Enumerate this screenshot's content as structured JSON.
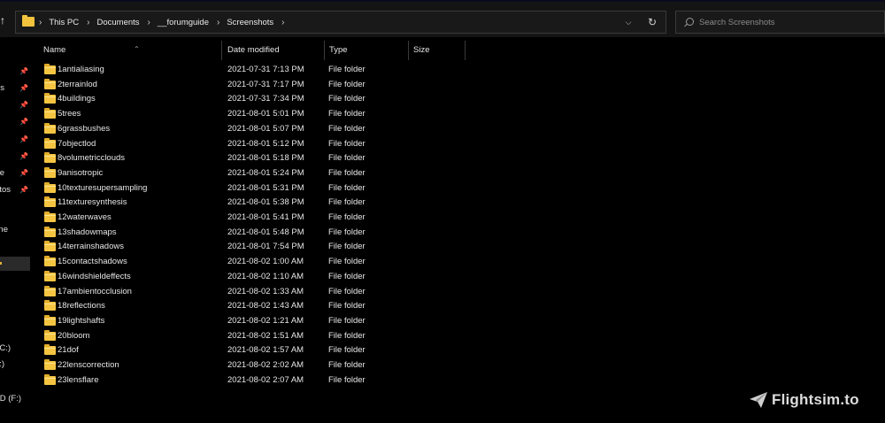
{
  "breadcrumb": [
    "This PC",
    "Documents",
    "__forumguide",
    "Screenshots"
  ],
  "search": {
    "placeholder": "Search Screenshots"
  },
  "nav": {
    "items": [
      {
        "label": "",
        "pinned": true,
        "name": "nav-item-1"
      },
      {
        "label": "s",
        "pinned": true,
        "name": "nav-item-2"
      },
      {
        "label": "",
        "pinned": true,
        "name": "nav-item-3"
      },
      {
        "label": "",
        "pinned": true,
        "name": "nav-item-4"
      },
      {
        "label": "",
        "pinned": true,
        "name": "nav-item-5"
      },
      {
        "label": "",
        "pinned": true,
        "name": "nav-item-6"
      },
      {
        "label": "e",
        "pinned": true,
        "name": "nav-item-7"
      },
      {
        "label": "tos",
        "pinned": true,
        "name": "nav-item-8"
      },
      {
        "label": "ne",
        "pinned": false,
        "name": "nav-item-onedrive"
      },
      {
        "label": "",
        "pinned": false,
        "name": "nav-item-this-pc"
      },
      {
        "label": "C:)",
        "pinned": false,
        "name": "nav-item-drive-c"
      },
      {
        "label": ":)",
        "pinned": false,
        "name": "nav-item-drive-d"
      },
      {
        "label": "ID (F:)",
        "pinned": false,
        "name": "nav-item-drive-f"
      }
    ]
  },
  "columns": {
    "name": "Name",
    "date": "Date modified",
    "type": "Type",
    "size": "Size"
  },
  "files": [
    {
      "name": "1antialiasing",
      "date": "2021-07-31 7:13 PM",
      "type": "File folder",
      "size": ""
    },
    {
      "name": "2terrainlod",
      "date": "2021-07-31 7:17 PM",
      "type": "File folder",
      "size": ""
    },
    {
      "name": "4buildings",
      "date": "2021-07-31 7:34 PM",
      "type": "File folder",
      "size": ""
    },
    {
      "name": "5trees",
      "date": "2021-08-01 5:01 PM",
      "type": "File folder",
      "size": ""
    },
    {
      "name": "6grassbushes",
      "date": "2021-08-01 5:07 PM",
      "type": "File folder",
      "size": ""
    },
    {
      "name": "7objectlod",
      "date": "2021-08-01 5:12 PM",
      "type": "File folder",
      "size": ""
    },
    {
      "name": "8volumetricclouds",
      "date": "2021-08-01 5:18 PM",
      "type": "File folder",
      "size": ""
    },
    {
      "name": "9anisotropic",
      "date": "2021-08-01 5:24 PM",
      "type": "File folder",
      "size": ""
    },
    {
      "name": "10texturesupersampling",
      "date": "2021-08-01 5:31 PM",
      "type": "File folder",
      "size": ""
    },
    {
      "name": "11texturesynthesis",
      "date": "2021-08-01 5:38 PM",
      "type": "File folder",
      "size": ""
    },
    {
      "name": "12waterwaves",
      "date": "2021-08-01 5:41 PM",
      "type": "File folder",
      "size": ""
    },
    {
      "name": "13shadowmaps",
      "date": "2021-08-01 5:48 PM",
      "type": "File folder",
      "size": ""
    },
    {
      "name": "14terrainshadows",
      "date": "2021-08-01 7:54 PM",
      "type": "File folder",
      "size": ""
    },
    {
      "name": "15contactshadows",
      "date": "2021-08-02 1:00 AM",
      "type": "File folder",
      "size": ""
    },
    {
      "name": "16windshieldeffects",
      "date": "2021-08-02 1:10 AM",
      "type": "File folder",
      "size": ""
    },
    {
      "name": "17ambientocclusion",
      "date": "2021-08-02 1:33 AM",
      "type": "File folder",
      "size": ""
    },
    {
      "name": "18reflections",
      "date": "2021-08-02 1:43 AM",
      "type": "File folder",
      "size": ""
    },
    {
      "name": "19lightshafts",
      "date": "2021-08-02 1:21 AM",
      "type": "File folder",
      "size": ""
    },
    {
      "name": "20bloom",
      "date": "2021-08-02 1:51 AM",
      "type": "File folder",
      "size": ""
    },
    {
      "name": "21dof",
      "date": "2021-08-02 1:57 AM",
      "type": "File folder",
      "size": ""
    },
    {
      "name": "22lenscorrection",
      "date": "2021-08-02 2:02 AM",
      "type": "File folder",
      "size": ""
    },
    {
      "name": "23lensflare",
      "date": "2021-08-02 2:07 AM",
      "type": "File folder",
      "size": ""
    }
  ],
  "watermark": {
    "text": "Flightsim.to"
  },
  "colors": {
    "folder": "#f5c542",
    "background": "#000000",
    "toolbar": "#141414",
    "accent": "#e0b03a"
  }
}
